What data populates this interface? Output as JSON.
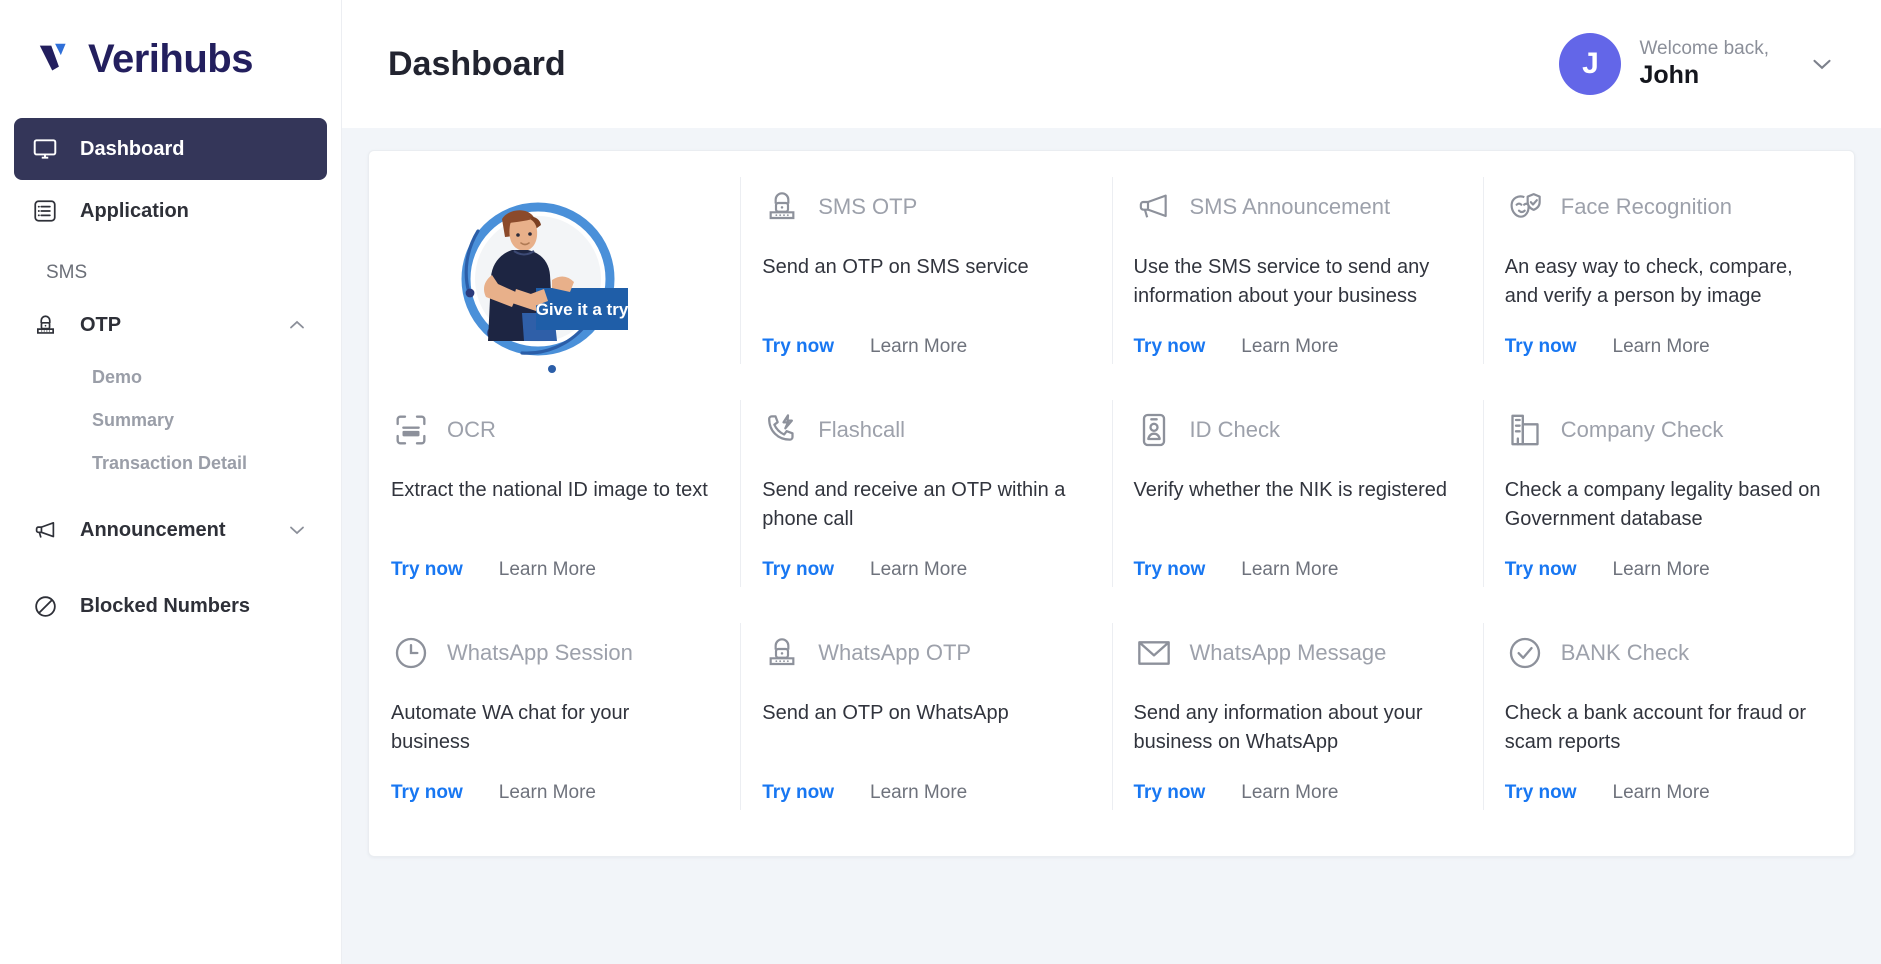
{
  "brand": {
    "name": "Verihubs",
    "logo_icon": "verihubs-logo-icon"
  },
  "sidebar": {
    "items": [
      {
        "id": "dashboard",
        "label": "Dashboard",
        "icon": "monitor-icon",
        "active": true
      },
      {
        "id": "application",
        "label": "Application",
        "icon": "list-icon",
        "active": false
      }
    ],
    "section_label": "SMS",
    "otp": {
      "label": "OTP",
      "icon": "lock-keypad-icon",
      "chevron": "chevron-up-icon",
      "children": [
        {
          "id": "demo",
          "label": "Demo"
        },
        {
          "id": "summary",
          "label": "Summary"
        },
        {
          "id": "transaction-detail",
          "label": "Transaction Detail"
        }
      ]
    },
    "announcement": {
      "label": "Announcement",
      "icon": "megaphone-icon",
      "chevron": "chevron-down-icon"
    },
    "blocked_numbers": {
      "label": "Blocked Numbers",
      "icon": "block-icon"
    }
  },
  "header": {
    "title": "Dashboard",
    "welcome_text": "Welcome back,",
    "user_name": "John",
    "avatar_initial": "J",
    "avatar_color": "#6366e8",
    "chevron": "chevron-down-icon"
  },
  "hero": {
    "banner_text": "Give it a try",
    "illustration": "person-pointing-illustration"
  },
  "actions": {
    "try_now": "Try now",
    "learn_more": "Learn More"
  },
  "colors": {
    "accent": "#1877f2",
    "sidebar_active": "#343659",
    "brand": "#231f5e"
  },
  "cards": [
    {
      "id": "sms-otp",
      "title": "SMS OTP",
      "desc": "Send an OTP on SMS service",
      "icon": "lock-keypad-icon"
    },
    {
      "id": "sms-announcement",
      "title": "SMS Announcement",
      "desc": "Use the SMS service to send any information about your business",
      "icon": "megaphone-icon"
    },
    {
      "id": "face-recognition",
      "title": "Face Recognition",
      "desc": "An easy way to check, compare, and verify a person by image",
      "icon": "face-shield-icon"
    },
    {
      "id": "ocr",
      "title": "OCR",
      "desc": "Extract the national ID image to text",
      "icon": "scan-card-icon"
    },
    {
      "id": "flashcall",
      "title": "Flashcall",
      "desc": "Send and receive an OTP within a phone call",
      "icon": "phone-bolt-icon"
    },
    {
      "id": "id-check",
      "title": "ID Check",
      "desc": "Verify whether the NIK is registered",
      "icon": "id-card-icon"
    },
    {
      "id": "company-check",
      "title": "Company Check",
      "desc": "Check a company legality based on Government database",
      "icon": "building-icon"
    },
    {
      "id": "whatsapp-session",
      "title": "WhatsApp Session",
      "desc": "Automate WA chat for your business",
      "icon": "clock-icon"
    },
    {
      "id": "whatsapp-otp",
      "title": "WhatsApp OTP",
      "desc": "Send an OTP on WhatsApp",
      "icon": "lock-keypad-icon"
    },
    {
      "id": "whatsapp-message",
      "title": "WhatsApp Message",
      "desc": "Send any information about your business on WhatsApp",
      "icon": "envelope-icon"
    },
    {
      "id": "bank-check",
      "title": "BANK Check",
      "desc": "Check a bank account for fraud or scam reports",
      "icon": "check-circle-icon"
    }
  ]
}
